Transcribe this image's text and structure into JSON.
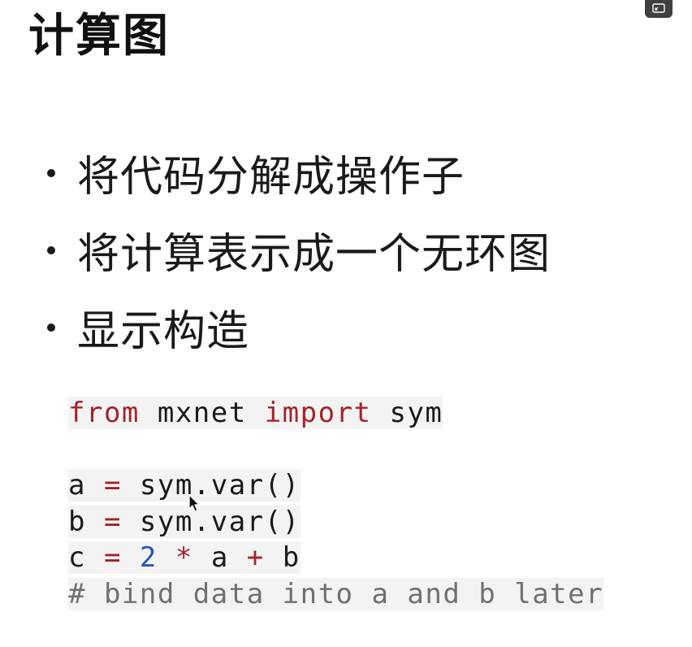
{
  "slide": {
    "title": "计算图",
    "bullets": [
      "将代码分解成操作子",
      "将计算表示成一个无环图",
      "显示构造"
    ]
  },
  "code": {
    "line1": {
      "kw1": "from",
      "mod": " mxnet ",
      "kw2": "import",
      "name": " sym"
    },
    "line2": {
      "var": "a ",
      "op": "=",
      "rest": " sym.var()"
    },
    "line3": {
      "var": "b ",
      "op": "=",
      "rest": " sym.var()"
    },
    "line4": {
      "var": "c ",
      "eq": "=",
      "sp1": " ",
      "num": "2",
      "sp2": " ",
      "mul": "*",
      "mid": " a ",
      "plus": "+",
      "end": " b"
    },
    "line5": "# bind data into a and b later"
  },
  "icons": {
    "corner": "expand-icon",
    "pointer": "mouse-cursor-icon"
  },
  "colors": {
    "keyword": "#a1242c",
    "number": "#2a55b8",
    "comment": "#707070",
    "code_bg": "#f3f3f3"
  }
}
